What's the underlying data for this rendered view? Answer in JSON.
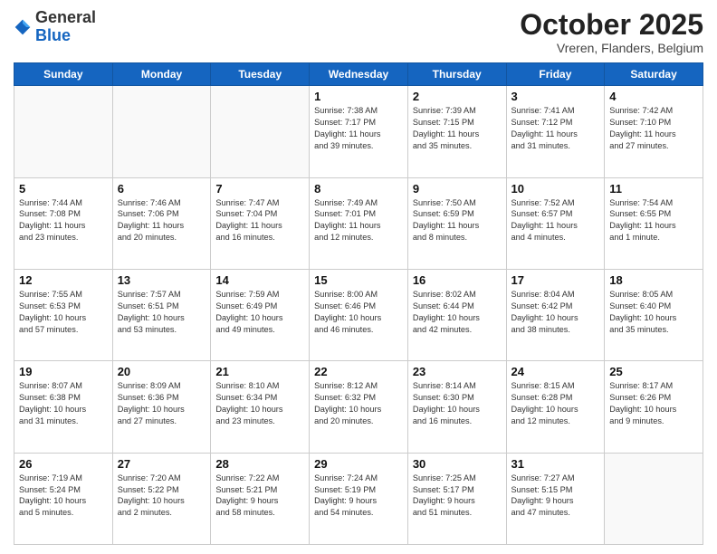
{
  "header": {
    "logo_general": "General",
    "logo_blue": "Blue",
    "month_title": "October 2025",
    "location": "Vreren, Flanders, Belgium"
  },
  "days_of_week": [
    "Sunday",
    "Monday",
    "Tuesday",
    "Wednesday",
    "Thursday",
    "Friday",
    "Saturday"
  ],
  "weeks": [
    [
      {
        "day": "",
        "text": ""
      },
      {
        "day": "",
        "text": ""
      },
      {
        "day": "",
        "text": ""
      },
      {
        "day": "1",
        "text": "Sunrise: 7:38 AM\nSunset: 7:17 PM\nDaylight: 11 hours\nand 39 minutes."
      },
      {
        "day": "2",
        "text": "Sunrise: 7:39 AM\nSunset: 7:15 PM\nDaylight: 11 hours\nand 35 minutes."
      },
      {
        "day": "3",
        "text": "Sunrise: 7:41 AM\nSunset: 7:12 PM\nDaylight: 11 hours\nand 31 minutes."
      },
      {
        "day": "4",
        "text": "Sunrise: 7:42 AM\nSunset: 7:10 PM\nDaylight: 11 hours\nand 27 minutes."
      }
    ],
    [
      {
        "day": "5",
        "text": "Sunrise: 7:44 AM\nSunset: 7:08 PM\nDaylight: 11 hours\nand 23 minutes."
      },
      {
        "day": "6",
        "text": "Sunrise: 7:46 AM\nSunset: 7:06 PM\nDaylight: 11 hours\nand 20 minutes."
      },
      {
        "day": "7",
        "text": "Sunrise: 7:47 AM\nSunset: 7:04 PM\nDaylight: 11 hours\nand 16 minutes."
      },
      {
        "day": "8",
        "text": "Sunrise: 7:49 AM\nSunset: 7:01 PM\nDaylight: 11 hours\nand 12 minutes."
      },
      {
        "day": "9",
        "text": "Sunrise: 7:50 AM\nSunset: 6:59 PM\nDaylight: 11 hours\nand 8 minutes."
      },
      {
        "day": "10",
        "text": "Sunrise: 7:52 AM\nSunset: 6:57 PM\nDaylight: 11 hours\nand 4 minutes."
      },
      {
        "day": "11",
        "text": "Sunrise: 7:54 AM\nSunset: 6:55 PM\nDaylight: 11 hours\nand 1 minute."
      }
    ],
    [
      {
        "day": "12",
        "text": "Sunrise: 7:55 AM\nSunset: 6:53 PM\nDaylight: 10 hours\nand 57 minutes."
      },
      {
        "day": "13",
        "text": "Sunrise: 7:57 AM\nSunset: 6:51 PM\nDaylight: 10 hours\nand 53 minutes."
      },
      {
        "day": "14",
        "text": "Sunrise: 7:59 AM\nSunset: 6:49 PM\nDaylight: 10 hours\nand 49 minutes."
      },
      {
        "day": "15",
        "text": "Sunrise: 8:00 AM\nSunset: 6:46 PM\nDaylight: 10 hours\nand 46 minutes."
      },
      {
        "day": "16",
        "text": "Sunrise: 8:02 AM\nSunset: 6:44 PM\nDaylight: 10 hours\nand 42 minutes."
      },
      {
        "day": "17",
        "text": "Sunrise: 8:04 AM\nSunset: 6:42 PM\nDaylight: 10 hours\nand 38 minutes."
      },
      {
        "day": "18",
        "text": "Sunrise: 8:05 AM\nSunset: 6:40 PM\nDaylight: 10 hours\nand 35 minutes."
      }
    ],
    [
      {
        "day": "19",
        "text": "Sunrise: 8:07 AM\nSunset: 6:38 PM\nDaylight: 10 hours\nand 31 minutes."
      },
      {
        "day": "20",
        "text": "Sunrise: 8:09 AM\nSunset: 6:36 PM\nDaylight: 10 hours\nand 27 minutes."
      },
      {
        "day": "21",
        "text": "Sunrise: 8:10 AM\nSunset: 6:34 PM\nDaylight: 10 hours\nand 23 minutes."
      },
      {
        "day": "22",
        "text": "Sunrise: 8:12 AM\nSunset: 6:32 PM\nDaylight: 10 hours\nand 20 minutes."
      },
      {
        "day": "23",
        "text": "Sunrise: 8:14 AM\nSunset: 6:30 PM\nDaylight: 10 hours\nand 16 minutes."
      },
      {
        "day": "24",
        "text": "Sunrise: 8:15 AM\nSunset: 6:28 PM\nDaylight: 10 hours\nand 12 minutes."
      },
      {
        "day": "25",
        "text": "Sunrise: 8:17 AM\nSunset: 6:26 PM\nDaylight: 10 hours\nand 9 minutes."
      }
    ],
    [
      {
        "day": "26",
        "text": "Sunrise: 7:19 AM\nSunset: 5:24 PM\nDaylight: 10 hours\nand 5 minutes."
      },
      {
        "day": "27",
        "text": "Sunrise: 7:20 AM\nSunset: 5:22 PM\nDaylight: 10 hours\nand 2 minutes."
      },
      {
        "day": "28",
        "text": "Sunrise: 7:22 AM\nSunset: 5:21 PM\nDaylight: 9 hours\nand 58 minutes."
      },
      {
        "day": "29",
        "text": "Sunrise: 7:24 AM\nSunset: 5:19 PM\nDaylight: 9 hours\nand 54 minutes."
      },
      {
        "day": "30",
        "text": "Sunrise: 7:25 AM\nSunset: 5:17 PM\nDaylight: 9 hours\nand 51 minutes."
      },
      {
        "day": "31",
        "text": "Sunrise: 7:27 AM\nSunset: 5:15 PM\nDaylight: 9 hours\nand 47 minutes."
      },
      {
        "day": "",
        "text": ""
      }
    ]
  ]
}
